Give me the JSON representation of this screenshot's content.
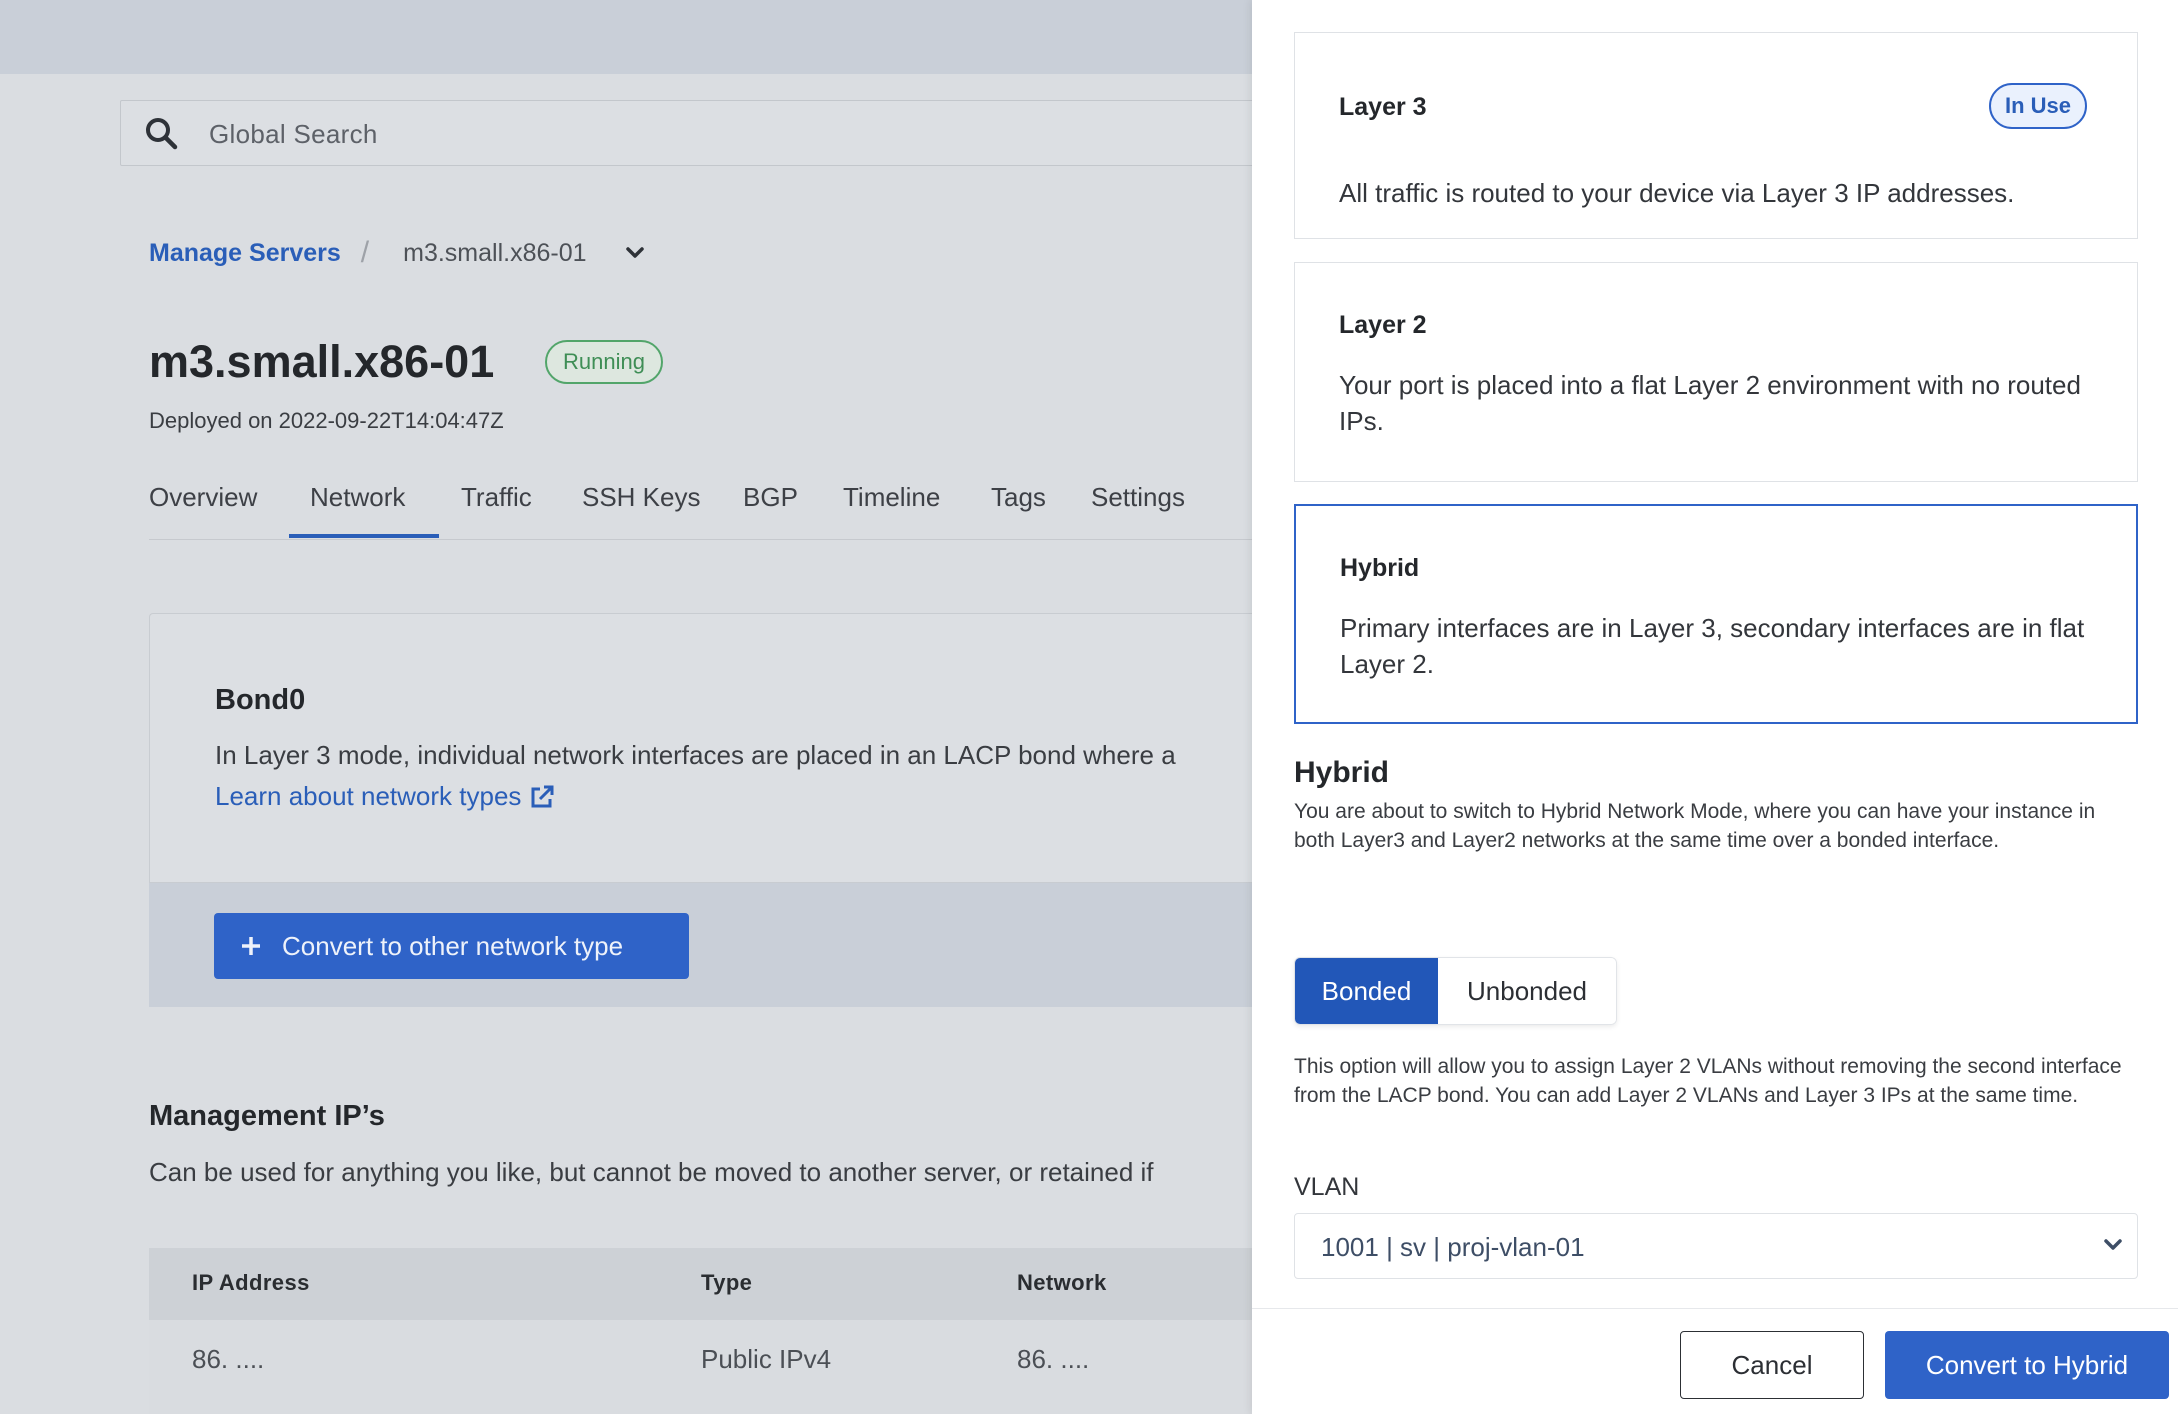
{
  "search": {
    "placeholder": "Global Search",
    "icon": "search-icon"
  },
  "breadcrumb": {
    "parent": "Manage Servers",
    "separator": "/",
    "current": "m3.small.x86-01"
  },
  "server": {
    "name": "m3.small.x86-01",
    "status": "Running",
    "deployed": "Deployed on 2022-09-22T14:04:47Z"
  },
  "tabs": [
    {
      "label": "Overview"
    },
    {
      "label": "Network",
      "active": true
    },
    {
      "label": "Traffic"
    },
    {
      "label": "SSH Keys"
    },
    {
      "label": "BGP"
    },
    {
      "label": "Timeline"
    },
    {
      "label": "Tags"
    },
    {
      "label": "Settings"
    }
  ],
  "bond": {
    "title": "Bond0",
    "description": "In Layer 3 mode, individual network interfaces are placed in an LACP bond where a",
    "link": "Learn about network types",
    "convert_button": "Convert to other network type"
  },
  "management": {
    "title": "Management IP’s",
    "description": "Can be used for anything you like, but cannot be moved to another server, or retained if",
    "columns": [
      "IP Address",
      "Type",
      "Network"
    ],
    "rows": [
      {
        "ip": "86. ....",
        "type": "Public IPv4",
        "network": "86. ...."
      }
    ]
  },
  "drawer": {
    "options": [
      {
        "title": "Layer 3",
        "badge": "In Use",
        "description": "All traffic is routed to your device via Layer 3 IP addresses."
      },
      {
        "title": "Layer 2",
        "description": "Your port is placed into a flat Layer 2 environment with no routed IPs."
      },
      {
        "title": "Hybrid",
        "description": "Primary interfaces are in Layer 3, secondary interfaces are in flat Layer 2.",
        "selected": true
      }
    ],
    "hybrid": {
      "heading": "Hybrid",
      "description": "You are about to switch to Hybrid Network Mode, where you can have your instance in both Layer3 and Layer2 networks at the same time over a bonded interface."
    },
    "bond_mode": {
      "options": [
        "Bonded",
        "Unbonded"
      ],
      "selected": "Bonded"
    },
    "bond_help": "This option will allow you to assign Layer 2 VLANs without removing the second interface from the LACP bond. You can add Layer 2 VLANs and Layer 3 IPs at the same time.",
    "vlan": {
      "label": "VLAN",
      "value": "1001 | sv | proj-vlan-01"
    },
    "cancel": "Cancel",
    "confirm": "Convert to Hybrid"
  },
  "colors": {
    "accent": "#2f63c8",
    "running": "#3f8e56"
  }
}
